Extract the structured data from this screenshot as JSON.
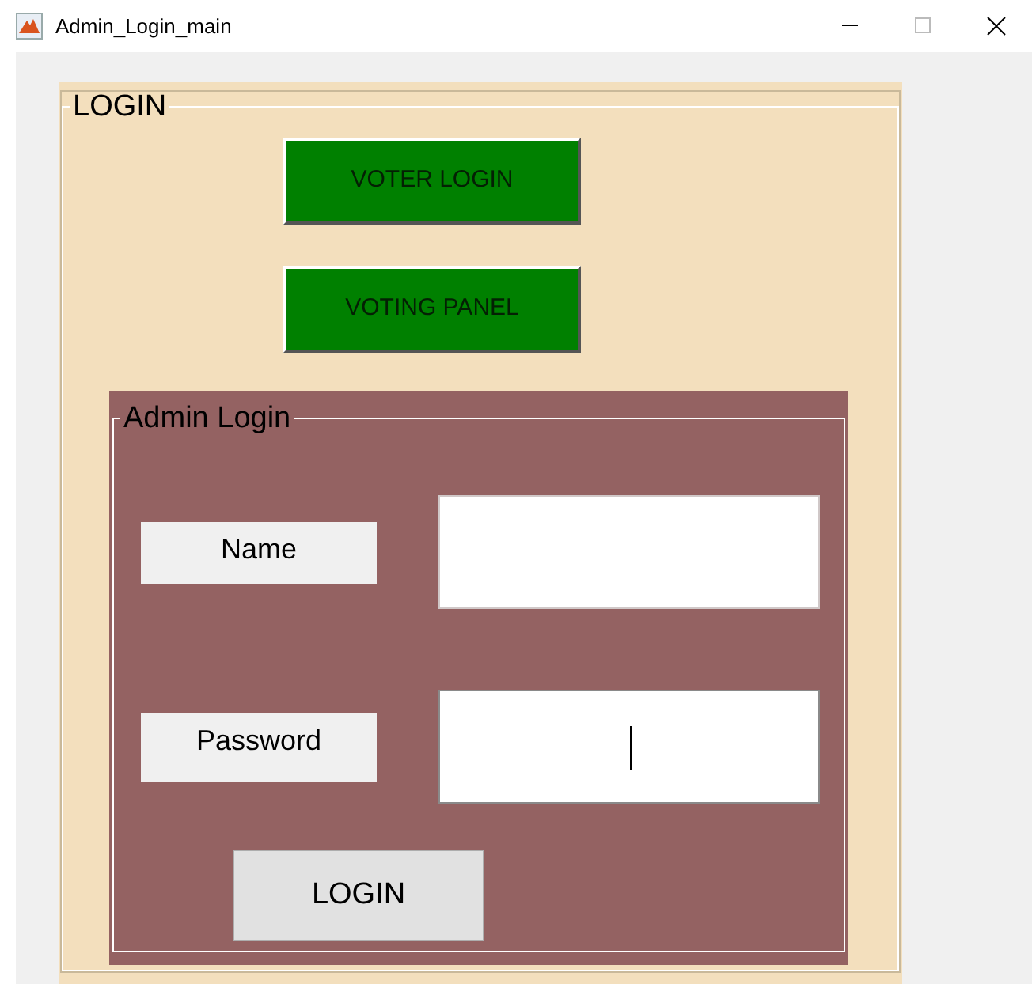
{
  "window": {
    "title": "Admin_Login_main"
  },
  "panel": {
    "title": "LOGIN"
  },
  "buttons": [
    {
      "label": "VOTER LOGIN"
    },
    {
      "label": "VOTING PANEL"
    }
  ],
  "admin_panel": {
    "title": "Admin Login",
    "fields": [
      {
        "label": "Name",
        "kind": "text",
        "focused": false
      },
      {
        "label": "Password",
        "kind": "password",
        "focused": true
      }
    ],
    "login_button": "LOGIN"
  }
}
